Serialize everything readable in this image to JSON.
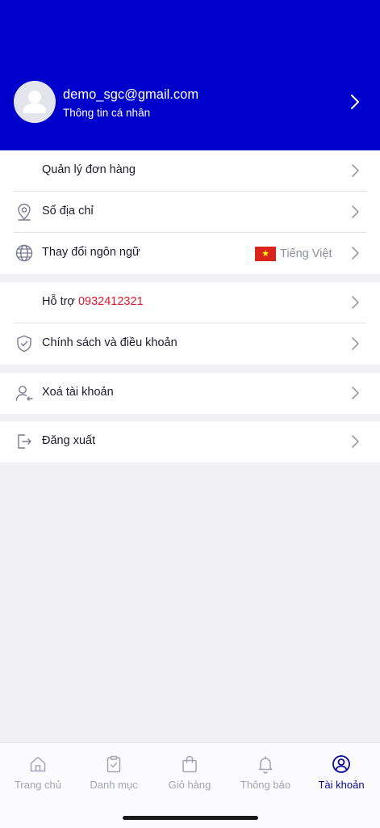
{
  "profile": {
    "email": "demo_sgc@gmail.com",
    "subtitle": "Thông tin cá nhân"
  },
  "menu": {
    "orders": "Quản lý đơn hàng",
    "address_book": "Sổ địa chỉ",
    "change_language": "Thay đổi ngôn ngữ",
    "current_language": "Tiếng Việt",
    "support_label": "Hỗ trợ",
    "support_phone": "0932412321",
    "policy": "Chính sách và điều khoản",
    "delete_account": "Xoá tài khoản",
    "logout": "Đăng xuất"
  },
  "tabs": [
    {
      "label": "Trang chủ",
      "icon": "home-icon",
      "active": false
    },
    {
      "label": "Danh mục",
      "icon": "clipboard-icon",
      "active": false
    },
    {
      "label": "Giỏ hàng",
      "icon": "shopping-bag-icon",
      "active": false
    },
    {
      "label": "Thông báo",
      "icon": "bell-icon",
      "active": false
    },
    {
      "label": "Tài khoản",
      "icon": "user-circle-icon",
      "active": true
    }
  ],
  "colors": {
    "brand": "#0000cc",
    "active_tab": "#0a0a9e",
    "inactive_tab": "#a4a4b4",
    "phone": "#e0182d",
    "background": "#f0f0f5"
  }
}
